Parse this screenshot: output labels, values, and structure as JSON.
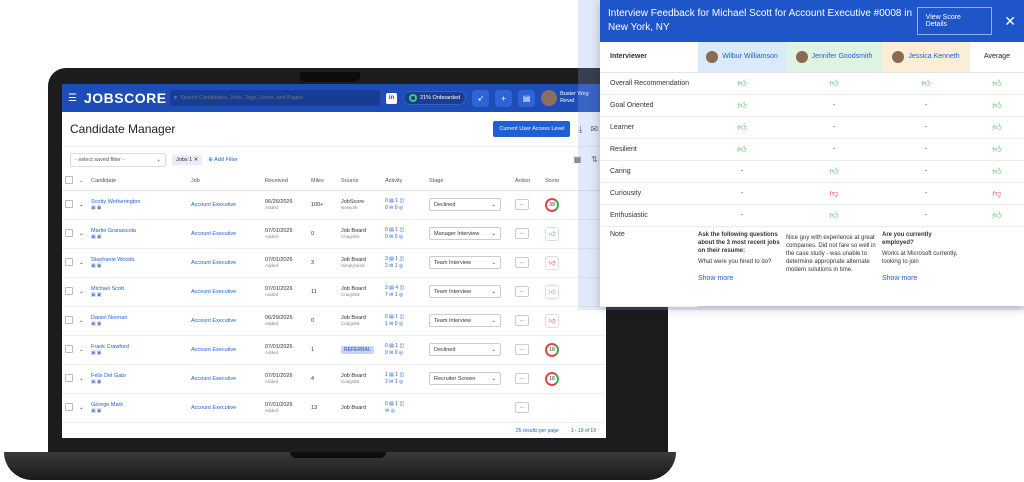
{
  "app": {
    "logo": "JOBSCORE",
    "search_placeholder": "Search Candidates, Jobs, Tags, Users, and Pages",
    "onboarded": "21% Onboarded",
    "user_name": "Buster Weg",
    "user_sub": "Revel"
  },
  "page": {
    "title": "Candidate Manager",
    "access_button": "Current User Access Level",
    "saved_filter_placeholder": "- select saved filter -",
    "chip_label": "Jobs",
    "chip_count": "1",
    "add_filter": "Add Filter"
  },
  "table": {
    "headers": [
      "Candidate",
      "Job",
      "Received",
      "Miles",
      "Source",
      "Activity",
      "Stage",
      "Action",
      "Score"
    ],
    "rows": [
      {
        "name": "Scotty Wetherington",
        "job": "Account Executive",
        "received": "06/26/2026",
        "received_sub": "Added",
        "miles": "100+",
        "source": "JobScore",
        "source_sub": "Network",
        "act1": "0",
        "act2": "0",
        "act3": "1",
        "act4": "0",
        "stage": "Declined",
        "score": "39"
      },
      {
        "name": "Martie Granascola",
        "job": "Account Executive",
        "received": "07/01/2026",
        "received_sub": "Added",
        "miles": "0",
        "source": "Job Board",
        "source_sub": "Craigslist",
        "act1": "0",
        "act2": "0",
        "act3": "1",
        "act4": "0",
        "stage": "Manager Interview",
        "score": ""
      },
      {
        "name": "Stephanie Woods",
        "job": "Account Executive",
        "received": "07/01/2026",
        "received_sub": "Added",
        "miles": "3",
        "source": "Job Board",
        "source_sub": "Simplyhired",
        "act1": "3",
        "act2": "2",
        "act3": "1",
        "act4": "1",
        "stage": "Team Interview",
        "score": ""
      },
      {
        "name": "Michael Scott",
        "job": "Account Executive",
        "received": "07/01/2026",
        "received_sub": "Added",
        "miles": "11",
        "source": "Job Board",
        "source_sub": "Craigslist",
        "act1": "3",
        "act2": "7",
        "act3": "4",
        "act4": "1",
        "stage": "Team Interview",
        "score": ""
      },
      {
        "name": "Daniel Noonan",
        "job": "Account Executive",
        "received": "06/29/2026",
        "received_sub": "Added",
        "miles": "0",
        "source": "Job Board",
        "source_sub": "Craigslist",
        "act1": "0",
        "act2": "1",
        "act3": "1",
        "act4": "0",
        "stage": "Team Interview",
        "score": ""
      },
      {
        "name": "Frank Crawford",
        "job": "Account Executive",
        "received": "07/01/2026",
        "received_sub": "Added",
        "miles": "1",
        "source": "REFERRAL",
        "source_sub": "",
        "act1": "0",
        "act2": "0",
        "act3": "1",
        "act4": "0",
        "stage": "Declined",
        "score": "18"
      },
      {
        "name": "Felix Del Gato",
        "job": "Account Executive",
        "received": "07/01/2026",
        "received_sub": "Added",
        "miles": "4",
        "source": "Job Board",
        "source_sub": "Craigslist",
        "act1": "1",
        "act2": "2",
        "act3": "1",
        "act4": "1",
        "stage": "Recruiter Screen",
        "score": "18"
      },
      {
        "name": "George Mark",
        "job": "Account Executive",
        "received": "07/01/2026",
        "received_sub": "Added",
        "miles": "13",
        "source": "Job Board",
        "source_sub": "",
        "act1": "0",
        "act2": "",
        "act3": "1",
        "act4": "",
        "stage": "",
        "score": ""
      }
    ],
    "results_per_page": "25 results per page",
    "pagination": "1 - 19 of 19"
  },
  "panel": {
    "title": "Interview Feedback for Michael Scott for Account Executive #0008 in New York, NY",
    "view_button": "View Score Details",
    "interviewer_label": "Interviewer",
    "interviewers": [
      {
        "name": "Wilbur Williamson",
        "bg": "#dbeafb"
      },
      {
        "name": "Jennifer Goodsmith",
        "bg": "#dff3e3"
      },
      {
        "name": "Jessica Kenneth",
        "bg": "#fbeed6"
      }
    ],
    "average_label": "Average",
    "criteria": [
      {
        "label": "Overall Recommendation",
        "v": [
          "up",
          "up",
          "up",
          "up"
        ]
      },
      {
        "label": "Goal Oriented",
        "v": [
          "up",
          "-",
          "-",
          "up"
        ]
      },
      {
        "label": "Learner",
        "v": [
          "up",
          "-",
          "-",
          "up"
        ]
      },
      {
        "label": "Resilient",
        "v": [
          "up",
          "-",
          "-",
          "up"
        ]
      },
      {
        "label": "Caring",
        "v": [
          "-",
          "up",
          "-",
          "up"
        ]
      },
      {
        "label": "Curiousity",
        "v": [
          "-",
          "down",
          "-",
          "down"
        ]
      },
      {
        "label": "Enthusiastic",
        "v": [
          "-",
          "up",
          "-",
          "up"
        ]
      }
    ],
    "note_label": "Note",
    "notes": [
      {
        "q": "Ask the following questions about the 3 most recent jobs on their resume:",
        "a": "What were you hired to do?",
        "show_more": "Show more"
      },
      {
        "q": "",
        "a": "Nice guy with experience at great companies. Did not fare so well in the case study - was unable to determine appropriate alternate modern solutions in time.",
        "show_more": ""
      },
      {
        "q": "Are you currently employed?",
        "a": "Works at Microsoft currently, looking to join",
        "show_more": "Show more"
      }
    ]
  },
  "colors": {
    "brand": "#1e4db7",
    "thumb_up": "#3fb34f",
    "thumb_down": "#e04646"
  }
}
